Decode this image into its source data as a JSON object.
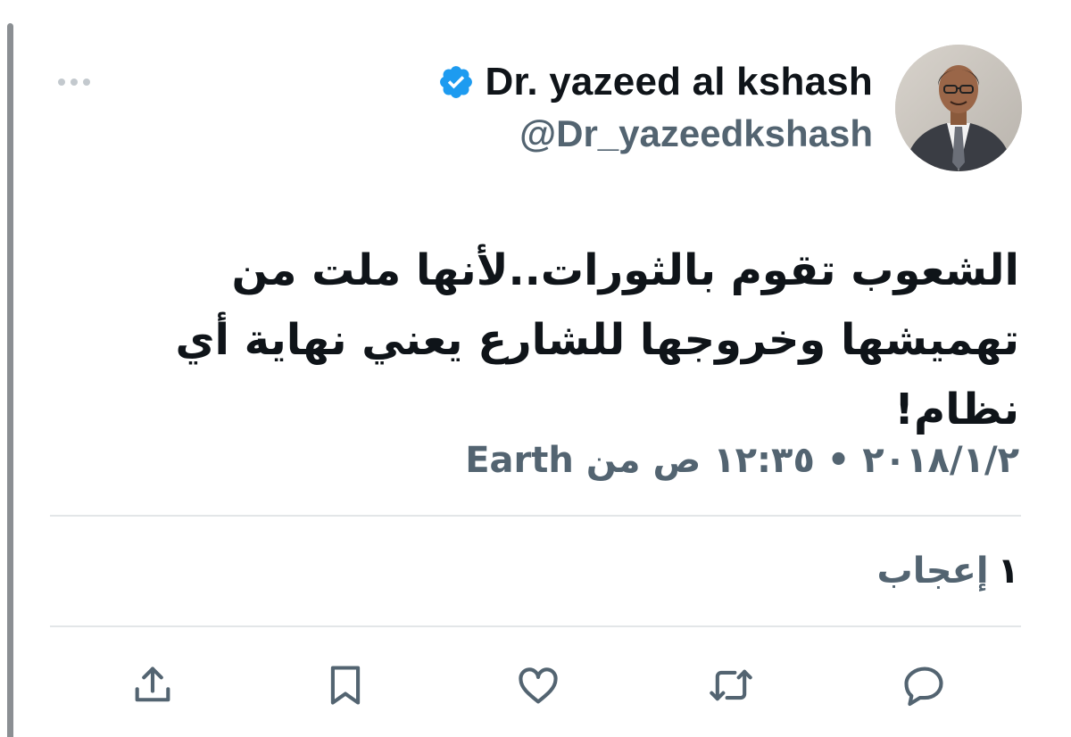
{
  "author": {
    "display_name": "Dr. yazeed al kshash",
    "handle": "@Dr_yazeedkshash",
    "verified": true,
    "avatar": "profile-photo"
  },
  "tweet": {
    "text": "الشعوب تقوم بالثورات..لأنها ملت من تهميشها وخروجها للشارع يعني نهاية أي نظام!",
    "meta": "٢٠١٨/١/٢ • ١٢:٣٥ ص من Earth"
  },
  "stats": {
    "likes_count": "١",
    "likes_label": "إعجاب"
  },
  "actions": {
    "icons": [
      "reply-icon",
      "retweet-icon",
      "like-icon",
      "bookmark-icon",
      "share-icon"
    ]
  },
  "colors": {
    "primary_text": "#0f1419",
    "secondary_text": "#536471",
    "verified_blue": "#1d9bf0",
    "divider": "#e3e6e8"
  }
}
